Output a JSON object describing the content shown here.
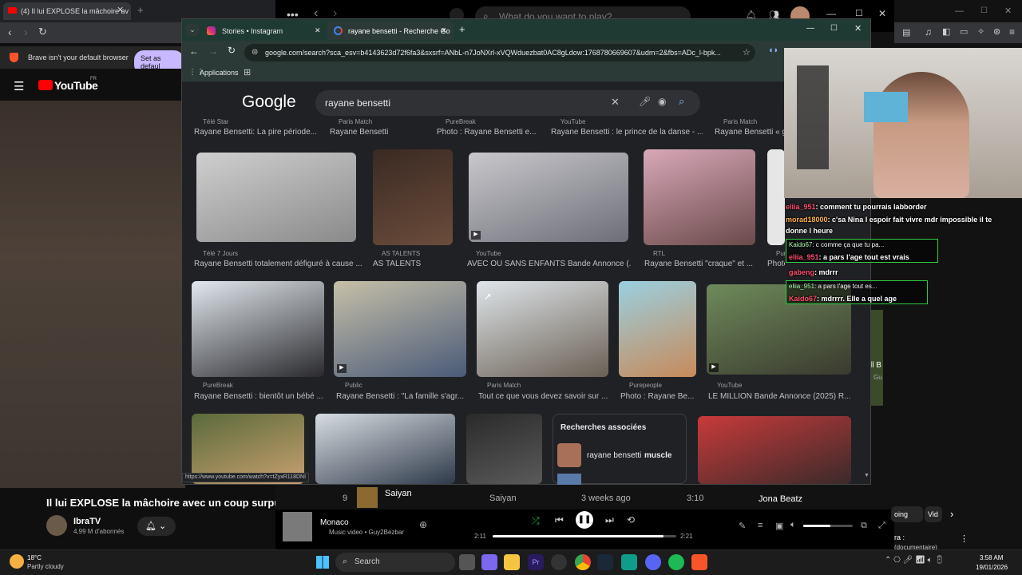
{
  "back_browser": {
    "tab_title": "(4) Il lui EXPLOSE la mâchoire av",
    "info_text": "Brave isn't your default browser",
    "default_button": "Set as defaul",
    "youtube_logo": "YouTube",
    "youtube_region": "FR",
    "video_title": "Il lui EXPLOSE la mâchoire avec un coup surpuis",
    "channel_name": "IbraTV",
    "subscribers": "4,99 M d'abonnés"
  },
  "music_app": {
    "search_placeholder": "What do you want to play?",
    "track_row": {
      "number": "9",
      "title": "Saiyan",
      "artist": "Saiyan",
      "added": "3 weeks ago",
      "duration": "3:10"
    },
    "side_artist": "Jona Beatz",
    "now_playing": {
      "title": "Monaco",
      "subtitle": "Music video • Guy2Bezbar",
      "elapsed": "2:11",
      "total": "2:21",
      "progress_fraction": 0.93
    },
    "volume_fraction": 0.55,
    "right_labels": {
      "going": "oing",
      "video": "Vid",
      "ra": "ra :",
      "doc": "(documentaire)",
      "b": "ll B",
      "g": "Gu"
    }
  },
  "chrome": {
    "tabs": [
      {
        "label": "Stories • Instagram",
        "active": false
      },
      {
        "label": "rayane bensetti - Recherche Go",
        "active": true
      }
    ],
    "url": "google.com/search?sca_esv=b4143623d72f6fa3&sxsrf=ANbL-n7JoNXrl-xVQWduezbat0AC8gLdow:1768780669607&udm=2&fbs=ADc_l-bpk...",
    "bookmark_apps": "Applications",
    "google_logo": "Google",
    "search_query": "rayane bensetti",
    "row0": [
      {
        "source": "Télé Star",
        "caption": "Rayane Bensetti: La pire période..."
      },
      {
        "source": "Paris Match",
        "caption": "Rayane Bensetti"
      },
      {
        "source": "PureBreak",
        "caption": "Photo : Rayane Bensetti e..."
      },
      {
        "source": "YouTube",
        "caption": "Rayane Bensetti : le prince de la danse - ..."
      },
      {
        "source": "Paris Match",
        "caption": "Rayane Bensetti « g"
      }
    ],
    "row1": [
      {
        "source": "Télé 7 Jours",
        "caption": "Rayane Bensetti totalement défiguré à cause ..."
      },
      {
        "source": "AS TALENTS",
        "caption": "AS TALENTS"
      },
      {
        "source": "YouTube",
        "caption": "AVEC OU SANS ENFANTS Bande Annonce (..."
      },
      {
        "source": "RTL",
        "caption": "Rayane Bensetti \"craque\" et ..."
      },
      {
        "source": "Purepeople",
        "caption": "Photo : Rayane Bens..."
      }
    ],
    "row2": [
      {
        "source": "PureBreak",
        "caption": "Rayane Bensetti : bientôt un bébé ..."
      },
      {
        "source": "Public",
        "caption": "Rayane Bensetti : \"La famille s'agr..."
      },
      {
        "source": "Paris Match",
        "caption": "Tout ce que vous devez savoir sur ..."
      },
      {
        "source": "Purepeople",
        "caption": "Photo : Rayane Be..."
      },
      {
        "source": "YouTube",
        "caption": "LE MILLION Bande Annonce (2025) R..."
      }
    ],
    "related": {
      "title": "Recherches associées",
      "item_prefix": "rayane bensetti",
      "item_bold": "muscle"
    },
    "url_tooltip": "https://www.youtube.com/watch?v=tZyxR118DNI"
  },
  "chat": [
    {
      "user": "eliia_951",
      "msg": ": comment tu pourrais labborder"
    },
    {
      "user": "morad18000",
      "msg": ": c'sa Nina l espoir fait vivre mdr impossible il te"
    },
    {
      "user": "",
      "msg": "donne l heure"
    },
    {
      "user": "Kaido67",
      "msg": ": c comme ça que tu pa..."
    },
    {
      "user": "eliia_951",
      "msg": ": a pars l'age tout est vrais"
    },
    {
      "user": "gabeng",
      "msg": ": mdrrr"
    },
    {
      "user": "eliia_951",
      "msg": ": a pars l'age tout es..."
    },
    {
      "user": "Kaido67",
      "msg": ": mdrrrr. Elle a quel age"
    }
  ],
  "taskbar": {
    "weather_temp": "18°C",
    "weather_desc": "Partly cloudy",
    "search_label": "Search",
    "time": "3:58 AM",
    "date": "19/01/2026"
  },
  "colors": {
    "accent_green": "#1db954",
    "chat_border": "#2ecc40",
    "google_bg": "#202124",
    "chrome_frame": "#1f3a33"
  }
}
